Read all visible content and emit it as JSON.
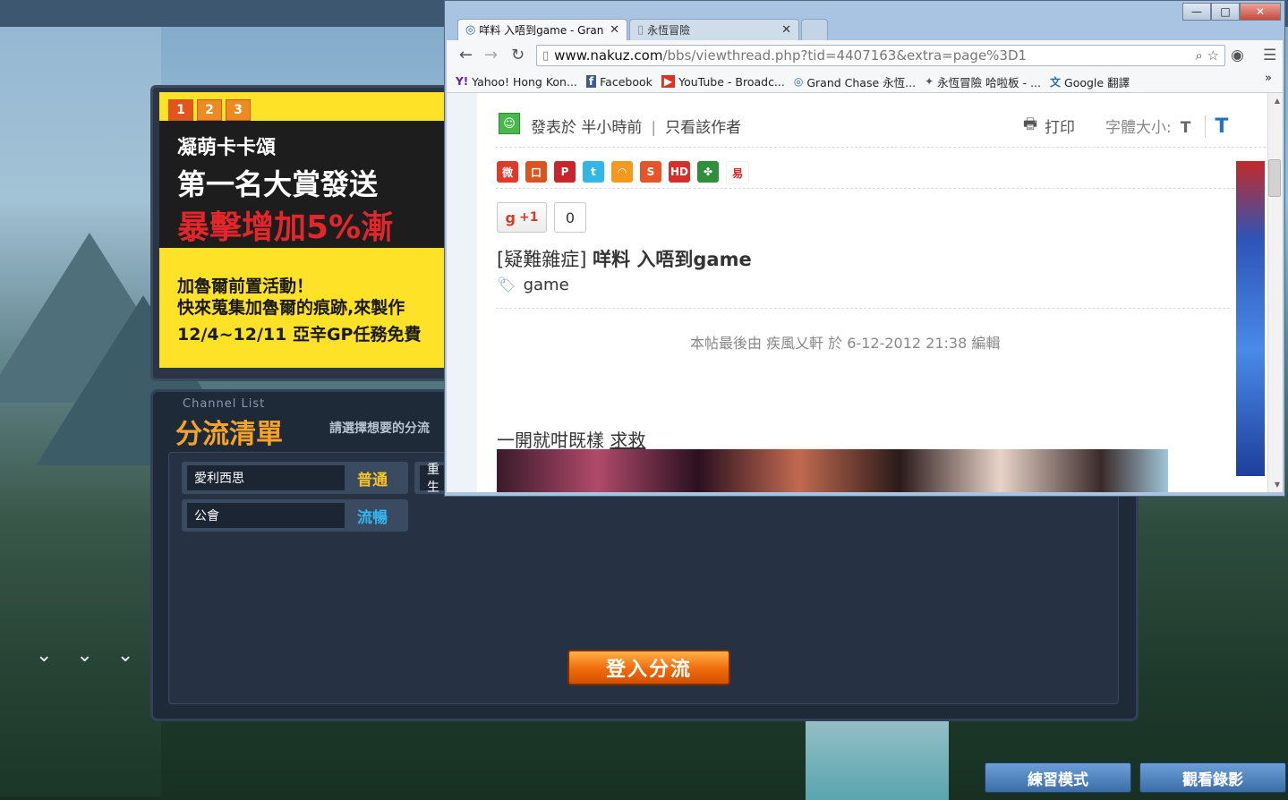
{
  "game": {
    "banner": {
      "tabs": [
        "1",
        "2",
        "3"
      ],
      "line1": "凝萌卡卡頌",
      "line2": "第一名大賞發送",
      "line3": "暴擊增加5%漸",
      "line4": "加魯爾前置活動！",
      "line5": "快來蒐集加魯爾的痕跡,來製作",
      "line6": "12/4~12/11 亞辛GP任務免費"
    },
    "channel_list": {
      "subtitle": "Channel List",
      "title": "分流清單",
      "hint": "請選擇想要的分流",
      "channels": [
        {
          "name": "愛利西思",
          "status": "普通"
        },
        {
          "name": "公會",
          "status": "流暢"
        },
        {
          "name": "重生",
          "status": ""
        }
      ],
      "login_button": "登入分流"
    },
    "bottom_buttons": {
      "practice": "練習模式",
      "replay": "觀看錄影"
    }
  },
  "browser": {
    "window_controls": {
      "minimize": "—",
      "maximize": "□",
      "close": "✕"
    },
    "tabs": [
      {
        "title": "咩料 入唔到game - Gran",
        "icon": "grandchase-icon"
      },
      {
        "title": "永恆冒險",
        "icon": "page-icon"
      }
    ],
    "address": {
      "host": "www.nakuz.com",
      "path": "/bbs/viewthread.php?tid=4407163&extra=page%3D1"
    },
    "bookmarks": [
      "Yahoo! Hong Kon...",
      "Facebook",
      "YouTube - Broadc...",
      "Grand Chase 永恆...",
      "永恆冒險 哈啦板 - ...",
      "Google 翻譯"
    ],
    "page": {
      "post_meta": "發表於 半小時前",
      "only_author": "只看該作者",
      "print": "打印",
      "font_size_label": "字體大小:",
      "font_small": "T",
      "font_large": "T",
      "gplus_label": "+1",
      "gplus_count": "0",
      "thread_category": "[疑難雜症]",
      "thread_title": "咩料 入唔到game",
      "tag": "game",
      "edit_note": "本帖最後由 疾風乂軒 於 6-12-2012 21:38 編輯",
      "body_text": "一開就咁既樣",
      "body_link": "求救"
    }
  },
  "colors": {
    "accent_orange": "#ef6a0b",
    "status_normal": "#f7c326",
    "status_smooth": "#35b6ef",
    "title_orange": "#f7a326"
  }
}
